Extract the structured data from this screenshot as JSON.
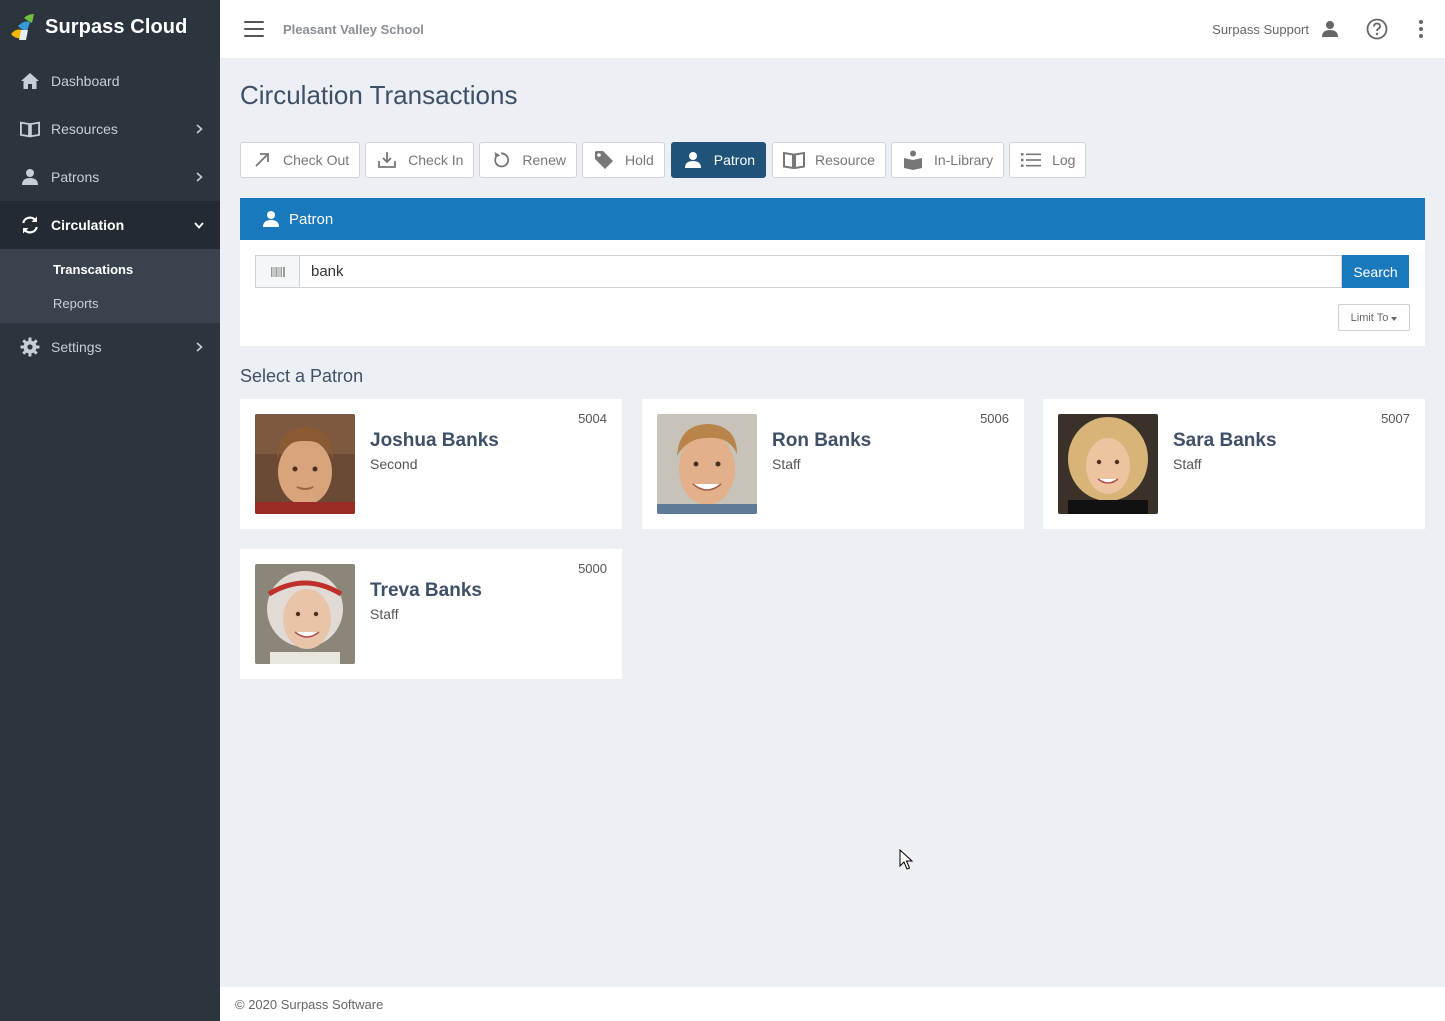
{
  "brand": {
    "name": "Surpass Cloud"
  },
  "sidebar": {
    "items": [
      {
        "label": "Dashboard",
        "icon": "home-icon"
      },
      {
        "label": "Resources",
        "icon": "book-icon"
      },
      {
        "label": "Patrons",
        "icon": "person-icon"
      },
      {
        "label": "Circulation",
        "icon": "refresh-icon"
      },
      {
        "label": "Settings",
        "icon": "gear-icon"
      }
    ],
    "circulation_sub": [
      {
        "label": "Transcations"
      },
      {
        "label": "Reports"
      }
    ]
  },
  "topbar": {
    "school": "Pleasant Valley School",
    "user": "Surpass Support"
  },
  "page": {
    "title": "Circulation Transactions"
  },
  "toolbar": {
    "buttons": [
      {
        "label": "Check Out",
        "icon": "arrow-up-right-icon"
      },
      {
        "label": "Check In",
        "icon": "download-icon"
      },
      {
        "label": "Renew",
        "icon": "renew-icon"
      },
      {
        "label": "Hold",
        "icon": "tag-icon"
      },
      {
        "label": "Patron",
        "icon": "person-icon",
        "active": true
      },
      {
        "label": "Resource",
        "icon": "book-icon"
      },
      {
        "label": "In-Library",
        "icon": "reader-icon"
      },
      {
        "label": "Log",
        "icon": "list-icon"
      }
    ]
  },
  "panel": {
    "title": "Patron",
    "search_value": "bank",
    "search_button": "Search",
    "limit_label": "Limit To"
  },
  "results": {
    "title": "Select a Patron",
    "patrons": [
      {
        "name": "Joshua Banks",
        "group": "Second",
        "id": "5004"
      },
      {
        "name": "Ron Banks",
        "group": "Staff",
        "id": "5006"
      },
      {
        "name": "Sara Banks",
        "group": "Staff",
        "id": "5007"
      },
      {
        "name": "Treva Banks",
        "group": "Staff",
        "id": "5000"
      }
    ]
  },
  "footer": {
    "text": "© 2020 Surpass Software"
  },
  "colors": {
    "sidebar": "#2c343d",
    "accent": "#1a78bd",
    "active_button": "#1f5478"
  }
}
